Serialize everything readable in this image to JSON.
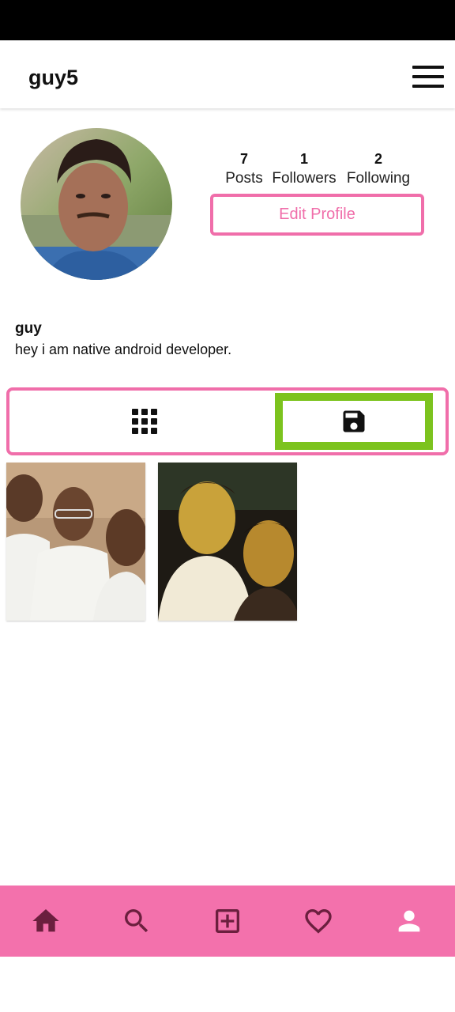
{
  "header": {
    "username": "guy5",
    "menu_icon": "hamburger-menu-icon"
  },
  "profile": {
    "avatar_icon": "profile-photo",
    "stats": [
      {
        "key": "posts",
        "value": "7",
        "label": "Posts"
      },
      {
        "key": "followers",
        "value": "1",
        "label": "Followers"
      },
      {
        "key": "following",
        "value": "2",
        "label": "Following"
      }
    ],
    "edit_button_label": "Edit Profile",
    "display_name": "guy",
    "bio": "hey i am native android developer."
  },
  "tabs": [
    {
      "name": "grid",
      "icon": "grid-icon",
      "selected": false
    },
    {
      "name": "saved",
      "icon": "save-icon",
      "selected": true
    }
  ],
  "posts": [
    {
      "index": 1,
      "kind": "group-photo-indoor"
    },
    {
      "index": 2,
      "kind": "selfie-night"
    }
  ],
  "bottom_nav": [
    {
      "name": "home",
      "icon": "home-icon"
    },
    {
      "name": "search",
      "icon": "search-icon"
    },
    {
      "name": "add",
      "icon": "add-box-icon"
    },
    {
      "name": "activity",
      "icon": "heart-icon"
    },
    {
      "name": "profile",
      "icon": "person-icon"
    }
  ],
  "colors": {
    "accent_pink": "#f06eaa",
    "nav_pink": "#f371ac",
    "nav_icon": "#6b1f3e",
    "highlight_green": "#7cc31e",
    "status_bar": "#000000"
  }
}
